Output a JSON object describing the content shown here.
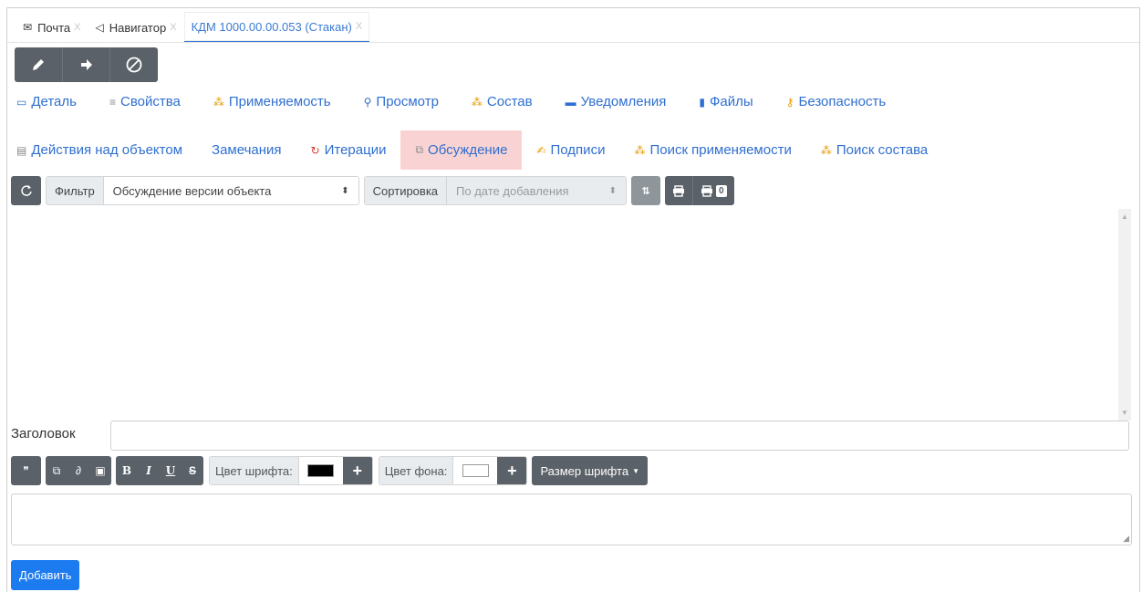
{
  "doc_tabs": [
    {
      "icon": "envelope-icon",
      "glyph": "✉",
      "label": "Почта",
      "close": "X"
    },
    {
      "icon": "navigator-icon",
      "glyph": "◁",
      "label": "Навигатор",
      "close": "X"
    },
    {
      "icon": "",
      "glyph": "",
      "label": "КДМ 1000.00.00.053 (Стакан)",
      "close": "X"
    }
  ],
  "object_tabs_row1": [
    {
      "icon": "detail-icon",
      "label": "Деталь"
    },
    {
      "icon": "properties-icon",
      "label": "Свойства"
    },
    {
      "icon": "hierarchy-icon",
      "label": "Применяемость"
    },
    {
      "icon": "magnifier-icon",
      "label": "Просмотр"
    },
    {
      "icon": "hierarchy-icon",
      "label": "Состав"
    },
    {
      "icon": "notification-icon",
      "label": "Уведомления"
    },
    {
      "icon": "file-icon",
      "label": "Файлы"
    },
    {
      "icon": "key-icon",
      "label": "Безопасность"
    }
  ],
  "object_tabs_row2": [
    {
      "icon": "list-icon",
      "label": "Действия над объектом"
    },
    {
      "icon": "",
      "label": "Замечания"
    },
    {
      "icon": "iteration-icon",
      "label": "Итерации"
    },
    {
      "icon": "discussion-icon",
      "label": "Обсуждение",
      "active": true
    },
    {
      "icon": "signature-icon",
      "label": "Подписи"
    },
    {
      "icon": "hierarchy-icon",
      "label": "Поиск применяемости"
    },
    {
      "icon": "hierarchy-icon",
      "label": "Поиск состава"
    }
  ],
  "toolbar": {
    "filter_label": "Фильтр",
    "filter_value": "Обсуждение версии объекта",
    "sort_label": "Сортировка",
    "sort_value": "По дате добавления",
    "print_badge": "0"
  },
  "form": {
    "header_label": "Заголовок",
    "header_value": "",
    "font_color_label": "Цвет шрифта:",
    "font_color": "#000000",
    "bg_color_label": "Цвет фона:",
    "bg_color": "#ffffff",
    "font_size_label": "Размер шрифта",
    "add_button": "Добавить",
    "body_value": ""
  },
  "colors": {
    "accent": "#2f6fd0",
    "active_tab_bg": "#f9d3d3",
    "button_dark": "#5a6168",
    "primary": "#1d7bf0"
  }
}
